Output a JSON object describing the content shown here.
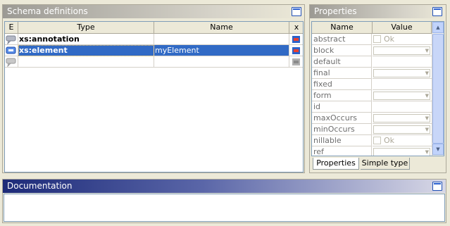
{
  "schema_panel": {
    "title": "Schema definitions",
    "columns": {
      "e": "E",
      "type": "Type",
      "name": "Name",
      "x": "x"
    },
    "rows": [
      {
        "type": "xs:annotation",
        "name": "",
        "selected": false
      },
      {
        "type": "xs:element",
        "name": "myElement",
        "selected": true
      },
      {
        "type": "",
        "name": "",
        "selected": false
      }
    ]
  },
  "properties_panel": {
    "title": "Properties",
    "columns": {
      "name": "Name",
      "value": "Value"
    },
    "rows": [
      {
        "name": "abstract",
        "kind": "checkbox",
        "label": "Ok"
      },
      {
        "name": "block",
        "kind": "combo"
      },
      {
        "name": "default",
        "kind": "text"
      },
      {
        "name": "final",
        "kind": "combo"
      },
      {
        "name": "fixed",
        "kind": "text"
      },
      {
        "name": "form",
        "kind": "combo"
      },
      {
        "name": "id",
        "kind": "text"
      },
      {
        "name": "maxOccurs",
        "kind": "combo"
      },
      {
        "name": "minOccurs",
        "kind": "combo"
      },
      {
        "name": "nillable",
        "kind": "checkbox",
        "label": "Ok"
      },
      {
        "name": "ref",
        "kind": "combo"
      }
    ],
    "tabs": [
      {
        "label": "Properties",
        "active": true
      },
      {
        "label": "Simple type",
        "active": false
      }
    ]
  },
  "documentation_panel": {
    "title": "Documentation"
  },
  "colors": {
    "selection": "#316ac5",
    "title_blue": "#1c2a78",
    "border": "#7f9db9"
  }
}
